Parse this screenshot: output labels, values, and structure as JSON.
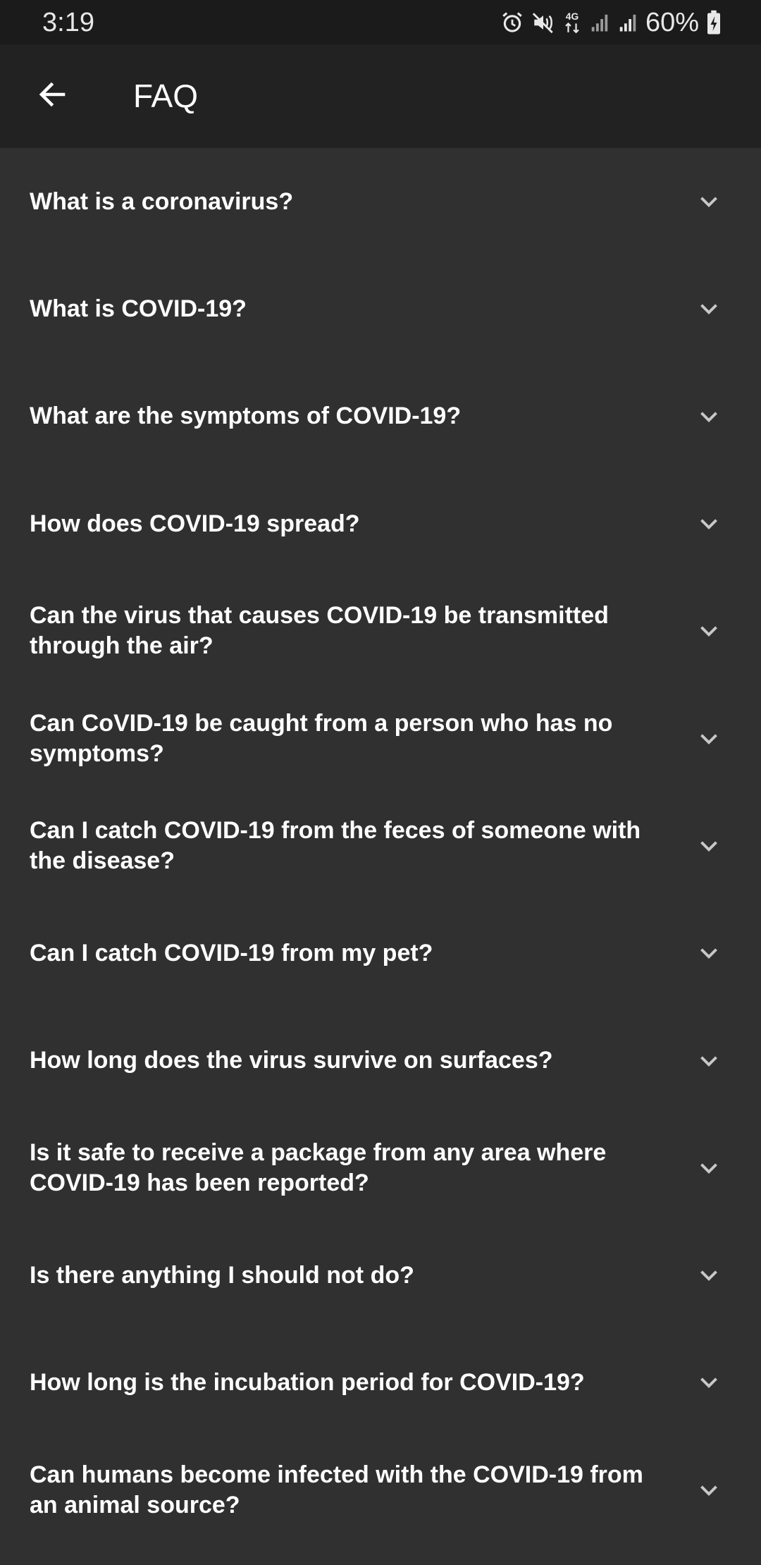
{
  "status_bar": {
    "time": "3:19",
    "battery_percent": "60%",
    "icons": [
      "alarm-icon",
      "mute-icon",
      "4g-data-icon",
      "signal-icon",
      "signal-icon",
      "battery-charging-icon"
    ]
  },
  "app_bar": {
    "title": "FAQ",
    "back_icon": "arrow-back-icon"
  },
  "faq": {
    "items": [
      {
        "question": "What is a coronavirus?"
      },
      {
        "question": "What is COVID-19?"
      },
      {
        "question": "What are the symptoms of COVID-19?"
      },
      {
        "question": "How does COVID-19 spread?"
      },
      {
        "question": "Can the virus that causes COVID-19 be transmitted through the air?"
      },
      {
        "question": "Can CoVID-19 be caught from a person who has no symptoms?"
      },
      {
        "question": "Can I catch COVID-19 from the feces of someone with the disease?"
      },
      {
        "question": "Can I catch COVID-19 from my pet?"
      },
      {
        "question": "How long does the virus survive on surfaces?"
      },
      {
        "question": "Is it safe to receive a package from any area where COVID-19 has been reported?"
      },
      {
        "question": "Is there anything I should not do?"
      },
      {
        "question": "How long is the incubation period for COVID-19?"
      },
      {
        "question": "Can humans become infected with the COVID-19 from an animal source?"
      }
    ]
  },
  "colors": {
    "background": "#303030",
    "app_bar": "#222222",
    "status_bar": "#1b1b1b",
    "text": "#ffffff",
    "chevron": "#c8c8c8"
  }
}
